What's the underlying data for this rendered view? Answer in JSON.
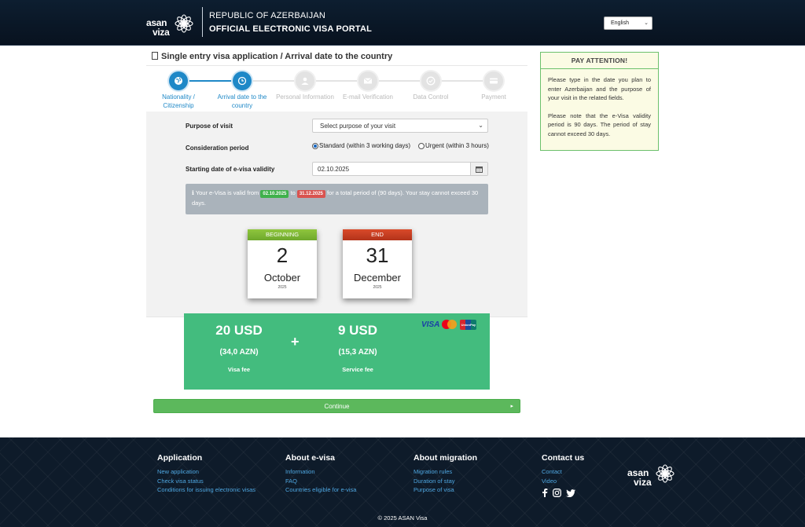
{
  "header": {
    "logo_line1": "asan",
    "logo_line2": "viza",
    "title_line1": "REPUBLIC OF AZERBAIJAN",
    "title_line2": "OFFICIAL ELECTRONIC VISA PORTAL",
    "language": "English"
  },
  "page": {
    "title": "Single entry visa application / Arrival date to the country"
  },
  "steps": [
    {
      "label": "Nationality / Citizenship",
      "icon": "globe-icon",
      "state": "active"
    },
    {
      "label": "Arrival date to the country",
      "icon": "clock-icon",
      "state": "active"
    },
    {
      "label": "Personal Information",
      "icon": "user-icon",
      "state": "inactive"
    },
    {
      "label": "E-mail Verification",
      "icon": "envelope-icon",
      "state": "inactive"
    },
    {
      "label": "Data Control",
      "icon": "check-circle-icon",
      "state": "inactive"
    },
    {
      "label": "Payment",
      "icon": "credit-card-icon",
      "state": "inactive"
    }
  ],
  "form": {
    "purpose_label": "Purpose of visit",
    "purpose_placeholder": "Select purpose of your visit",
    "consideration_label": "Consideration period",
    "option_standard": "Standard (within 3 working days)",
    "option_urgent": "Urgent (within 3 hours)",
    "selected_option": "standard",
    "start_date_label": "Starting date of e-visa validity",
    "start_date_value": "02.10.2025"
  },
  "info": {
    "prefix": "Your e-Visa is valid from",
    "from_date": "02.10.2025",
    "to_word": "to",
    "to_date": "31.12.2025",
    "suffix": "for a total period of (90 days). Your stay cannot exceed 30 days."
  },
  "calendar": {
    "begin": {
      "band": "BEGINNING",
      "day": "2",
      "month": "October",
      "year": "2025"
    },
    "end": {
      "band": "END",
      "day": "31",
      "month": "December",
      "year": "2025"
    }
  },
  "fees": {
    "visa_amount": "20 USD",
    "visa_azn": "(34,0 AZN)",
    "visa_label": "Visa fee",
    "plus": "+",
    "service_amount": "9 USD",
    "service_azn": "(15,3 AZN)",
    "service_label": "Service fee",
    "card_visa": "VISA",
    "card_unionpay": "UnionPay"
  },
  "continue_label": "Continue",
  "attention": {
    "title": "PAY ATTENTION!",
    "para1": "Please type in the date you plan to enter Azerbaijan and the purpose of your visit in the related fields.",
    "para2": "Please note that the e-Visa validity period is 90 days. The period of stay cannot exceed 30 days."
  },
  "footer": {
    "col1": {
      "title": "Application",
      "links": [
        "New application",
        "Check visa status",
        "Conditions for issuing electronic visas"
      ]
    },
    "col2": {
      "title": "About e-visa",
      "links": [
        "Information",
        "FAQ",
        "Countries eligible for e-visa"
      ]
    },
    "col3": {
      "title": "About migration",
      "links": [
        "Migration rules",
        "Duration of stay",
        "Purpose of visa"
      ]
    },
    "col4": {
      "title": "Contact us",
      "links": [
        "Contact",
        "Video"
      ]
    },
    "copyright": "© 2025 ASAN Visa"
  },
  "colors": {
    "accent": "#1e88c7",
    "fee_green": "#43bc7e",
    "continue_green": "#5cb85c",
    "header_bg": "#0d1e30"
  }
}
